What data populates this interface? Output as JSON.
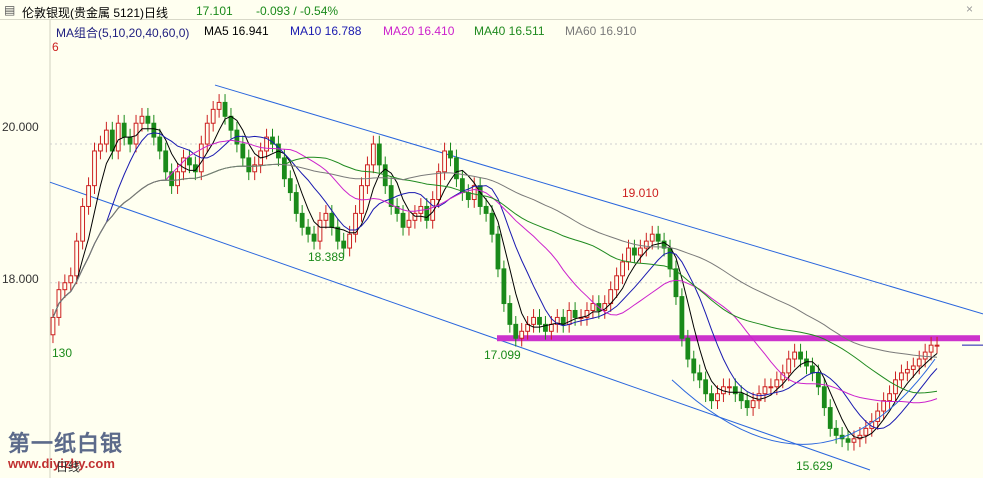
{
  "header": {
    "title": "伦敦银现(贵金属 5121)日线",
    "last": "17.101",
    "change": "-0.093 / -0.54%"
  },
  "ma_legend": [
    {
      "label": "MA组合(5,10,20,40,60,0)",
      "color": "#202080"
    },
    {
      "label": "MA5 16.941",
      "color": "#000000"
    },
    {
      "label": "MA10 16.788",
      "color": "#1a1ab0"
    },
    {
      "label": "MA20 16.410",
      "color": "#cc22cc"
    },
    {
      "label": "MA40 16.511",
      "color": "#1f8a1f"
    },
    {
      "label": "MA60 16.910",
      "color": "#7a7a7a"
    }
  ],
  "annotations": {
    "high_left": "6",
    "low_a": "18.389",
    "low_b": "17.099",
    "high_b": "19.010",
    "low_c": "15.629",
    "left_low": "130"
  },
  "watermark": {
    "brand": "第一纸白银",
    "site": "www.diyizby.com",
    "tag": "日线"
  },
  "chart_data": {
    "type": "candlestick",
    "title": "伦敦银现(贵金属 5121)日线",
    "ylim": [
      15.3,
      21.5
    ],
    "y_ticks": [
      18.0,
      20.0
    ],
    "up_color": "#cc2020",
    "down_color": "#1a8a1a",
    "support_level": 17.2,
    "support_color": "#cc33cc",
    "channel_color": "#2a66dd",
    "closes": [
      17.5,
      17.9,
      18.0,
      18.1,
      18.6,
      19.1,
      19.4,
      19.9,
      20.0,
      20.2,
      19.9,
      20.3,
      20.1,
      20.0,
      20.3,
      20.4,
      20.3,
      20.1,
      19.9,
      19.6,
      19.4,
      19.6,
      19.8,
      19.7,
      19.6,
      20.0,
      20.3,
      20.5,
      20.6,
      20.4,
      20.2,
      20.0,
      19.8,
      19.6,
      19.7,
      19.9,
      20.1,
      20.0,
      19.8,
      19.5,
      19.3,
      19.0,
      18.8,
      18.7,
      18.6,
      18.9,
      19.0,
      18.8,
      18.6,
      18.5,
      18.7,
      19.0,
      19.4,
      19.7,
      20.0,
      19.7,
      19.4,
      19.1,
      19.0,
      18.8,
      18.9,
      19.0,
      19.1,
      18.9,
      19.2,
      19.6,
      19.9,
      19.8,
      19.5,
      19.3,
      19.2,
      19.4,
      19.1,
      19.0,
      18.7,
      18.2,
      17.7,
      17.4,
      17.2,
      17.3,
      17.4,
      17.5,
      17.4,
      17.3,
      17.4,
      17.5,
      17.4,
      17.6,
      17.5,
      17.5,
      17.6,
      17.7,
      17.6,
      17.7,
      17.9,
      18.1,
      18.3,
      18.5,
      18.4,
      18.5,
      18.6,
      18.7,
      18.6,
      18.5,
      18.2,
      17.8,
      17.2,
      16.9,
      16.7,
      16.6,
      16.4,
      16.3,
      16.4,
      16.5,
      16.5,
      16.4,
      16.3,
      16.2,
      16.3,
      16.4,
      16.5,
      16.5,
      16.6,
      16.7,
      16.9,
      17.0,
      16.9,
      16.8,
      16.7,
      16.5,
      16.2,
      15.9,
      15.8,
      15.75,
      15.7,
      15.75,
      15.8,
      15.9,
      16.0,
      16.15,
      16.3,
      16.4,
      16.6,
      16.7,
      16.75,
      16.8,
      16.9,
      17.0,
      17.1,
      17.1
    ]
  }
}
